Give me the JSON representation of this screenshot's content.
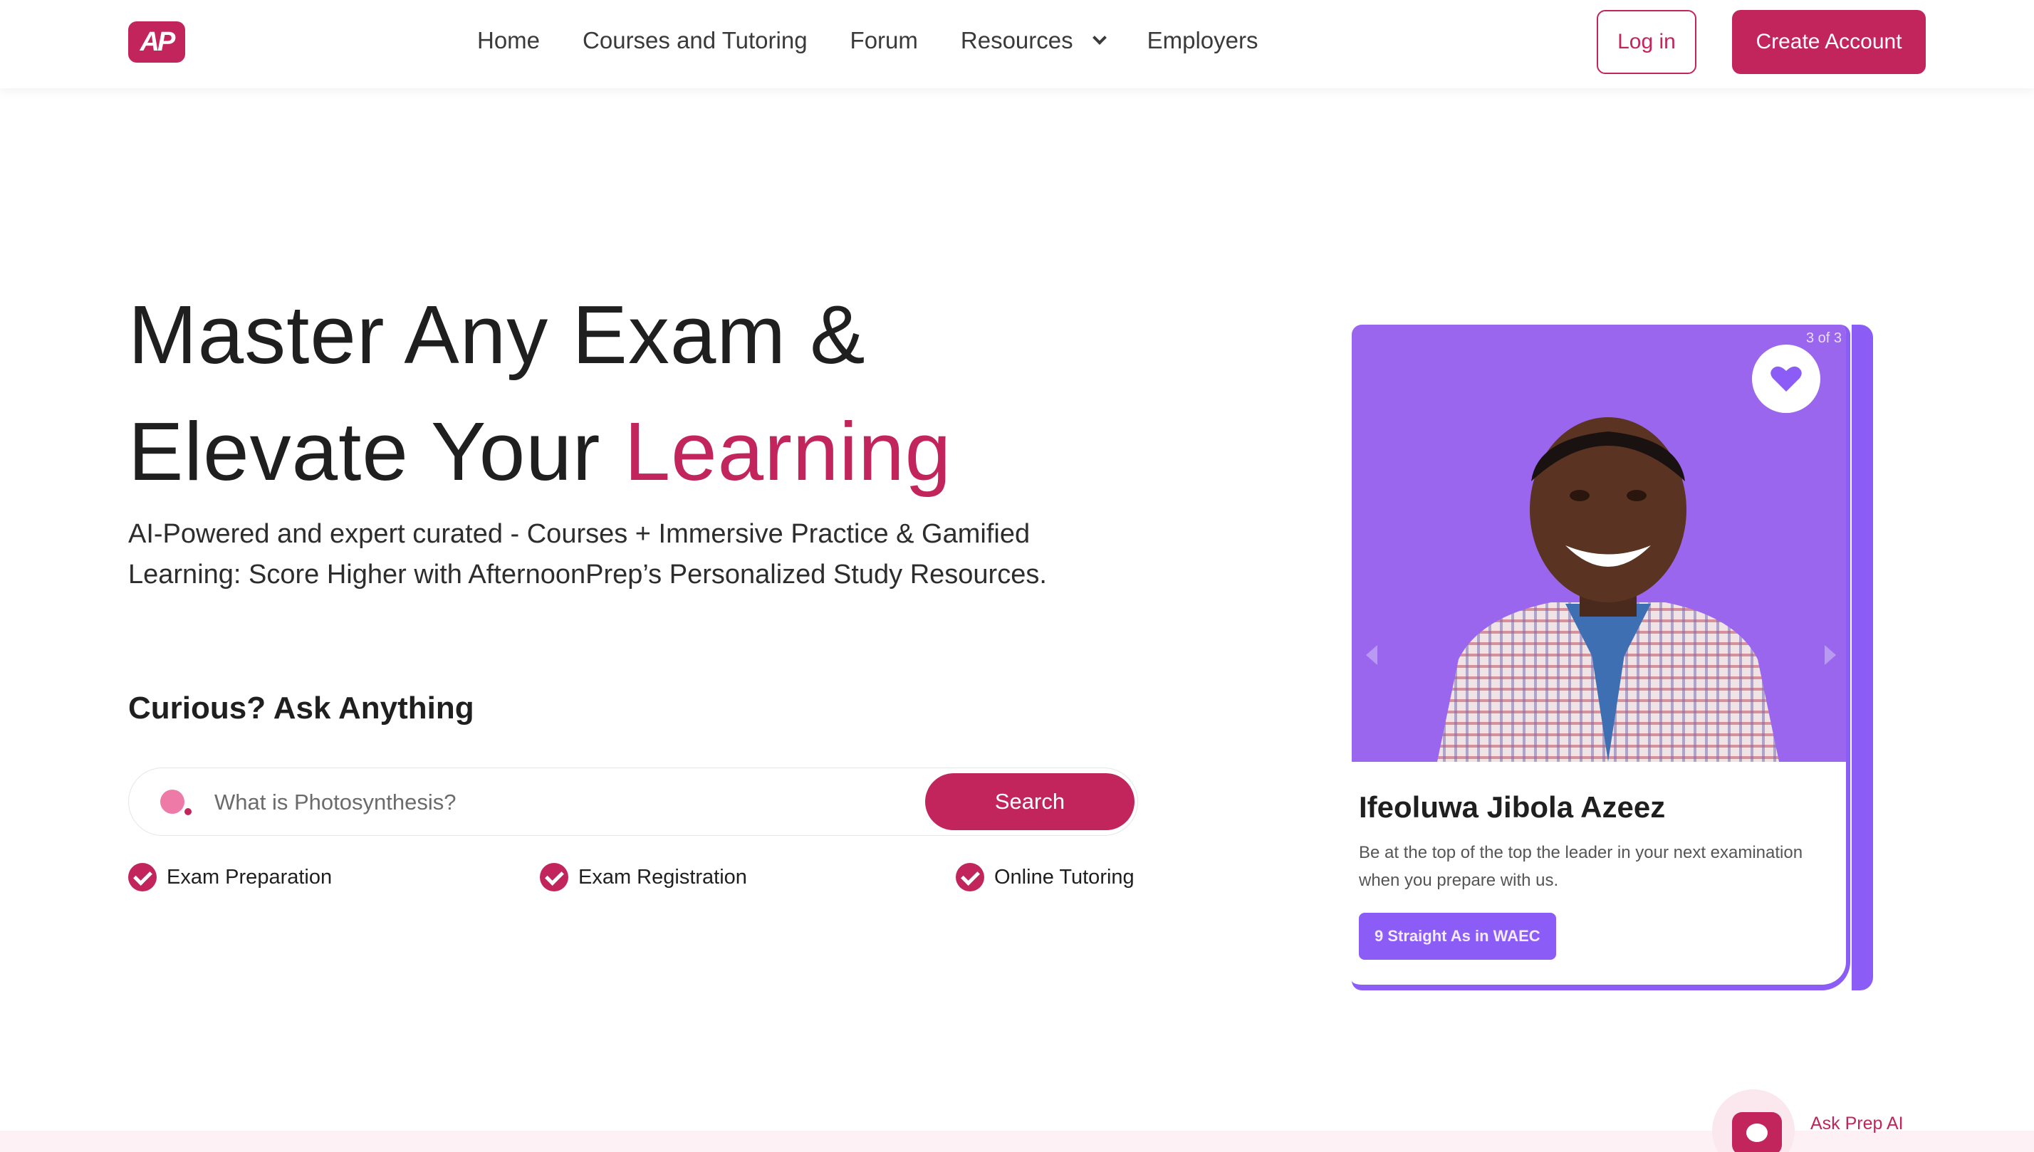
{
  "nav": {
    "logo_text": "AP",
    "links": [
      "Home",
      "Courses and Tutoring",
      "Forum",
      "Resources",
      "Employers"
    ],
    "login_label": "Log in",
    "create_account_label": "Create Account"
  },
  "hero": {
    "title_line1": "Master Any Exam &",
    "title_line2_prefix": "Elevate Your ",
    "title_line2_accent": "Learning",
    "subtitle": "AI-Powered and expert curated - Courses + Immersive Practice & Gamified Learning: Score Higher with AfternoonPrep’s Personalized Study Resources."
  },
  "ask": {
    "heading": "Curious? Ask Anything",
    "placeholder": "What is Photosynthesis?",
    "search_label": "Search",
    "features": [
      "Exam Preparation",
      "Exam Registration",
      "Online Tutoring"
    ]
  },
  "testimonial": {
    "counter": "3 of 3",
    "name": "Ifeoluwa Jibola Azeez",
    "description": "Be at the top of the top the leader in your next examination when you prepare with us.",
    "badge": "9 Straight As in WAEC"
  },
  "chat": {
    "label": "Ask Prep AI"
  },
  "colors": {
    "brand": "#c2255c",
    "card_purple": "#8b5cf6",
    "text": "#1f1f1f"
  }
}
